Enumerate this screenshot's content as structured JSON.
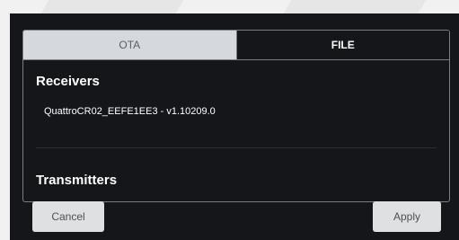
{
  "tabs": [
    {
      "label": "OTA",
      "active": false
    },
    {
      "label": "FILE",
      "active": true
    }
  ],
  "receivers": {
    "title": "Receivers",
    "items": [
      {
        "label": "QuattroCR02_EEFE1EE3 - v1.10209.0"
      }
    ]
  },
  "transmitters": {
    "title": "Transmitters"
  },
  "buttons": {
    "cancel": "Cancel",
    "apply": "Apply"
  },
  "colors": {
    "dialog_bg": "#14161a",
    "inactive_tab_bg": "#d5d8dc",
    "button_bg": "#dfe0e1",
    "page_bg": "#f1f1f1"
  }
}
